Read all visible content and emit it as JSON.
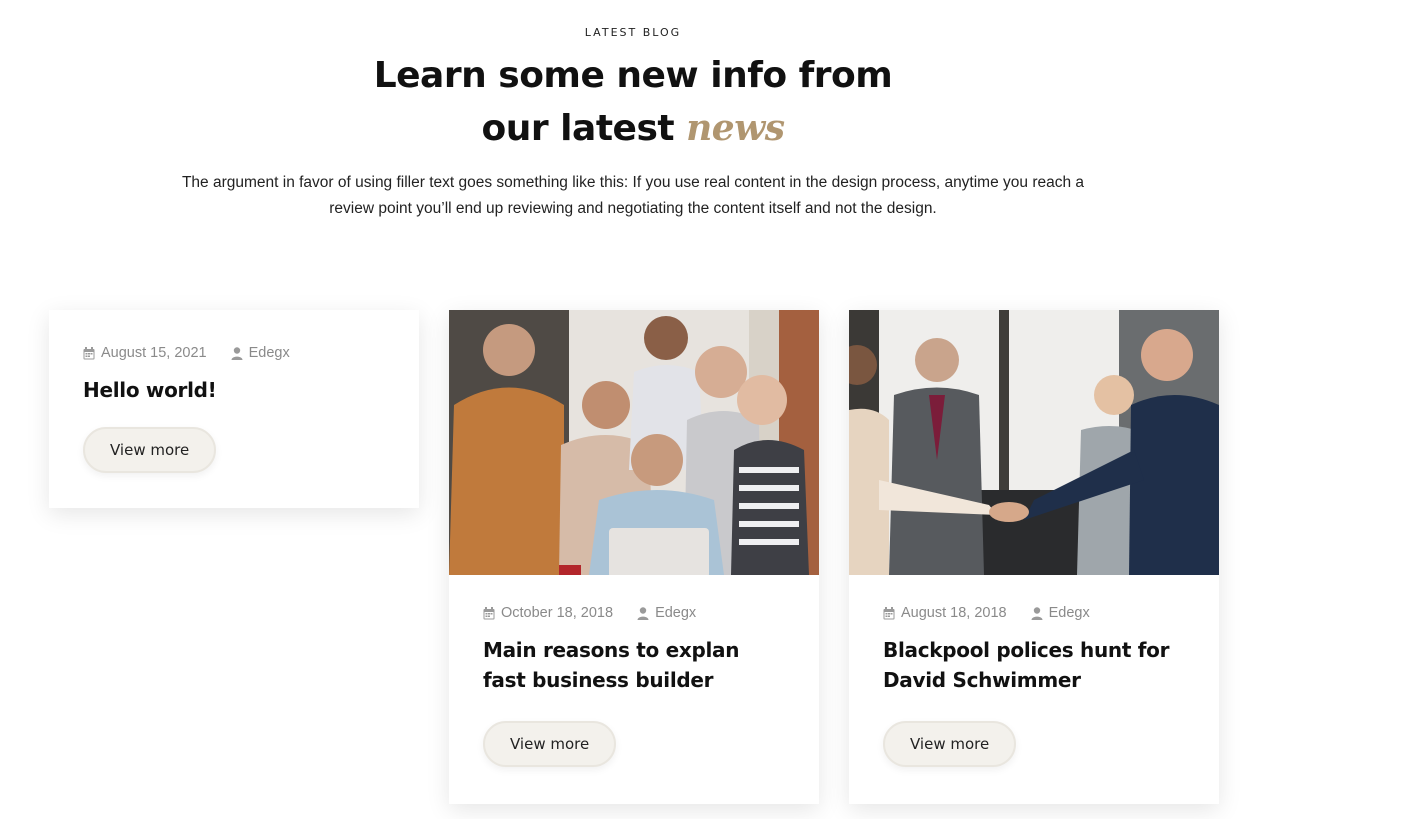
{
  "section": {
    "eyebrow": "LATEST BLOG",
    "headline_line1": "Learn some new info from",
    "headline_line2": "our latest",
    "headline_accent": "news",
    "intro": "The argument in favor of using filler text goes something like this: If you use real content in the design process, anytime you reach a review point you’ll end up reviewing and negotiating the content itself and not the design."
  },
  "posts": [
    {
      "date": "August 15, 2021",
      "author": "Edegx",
      "title": "Hello world!",
      "button": "View more"
    },
    {
      "date": "October 18, 2018",
      "author": "Edegx",
      "title": "Main reasons to explan fast business builder",
      "button": "View more"
    },
    {
      "date": "August 18, 2018",
      "author": "Edegx",
      "title": "Blackpool polices hunt for David Schwimmer",
      "button": "View more"
    }
  ],
  "colors": {
    "accent": "#b09670",
    "button_bg": "#f3f1ec",
    "meta": "#8a8a8a"
  }
}
